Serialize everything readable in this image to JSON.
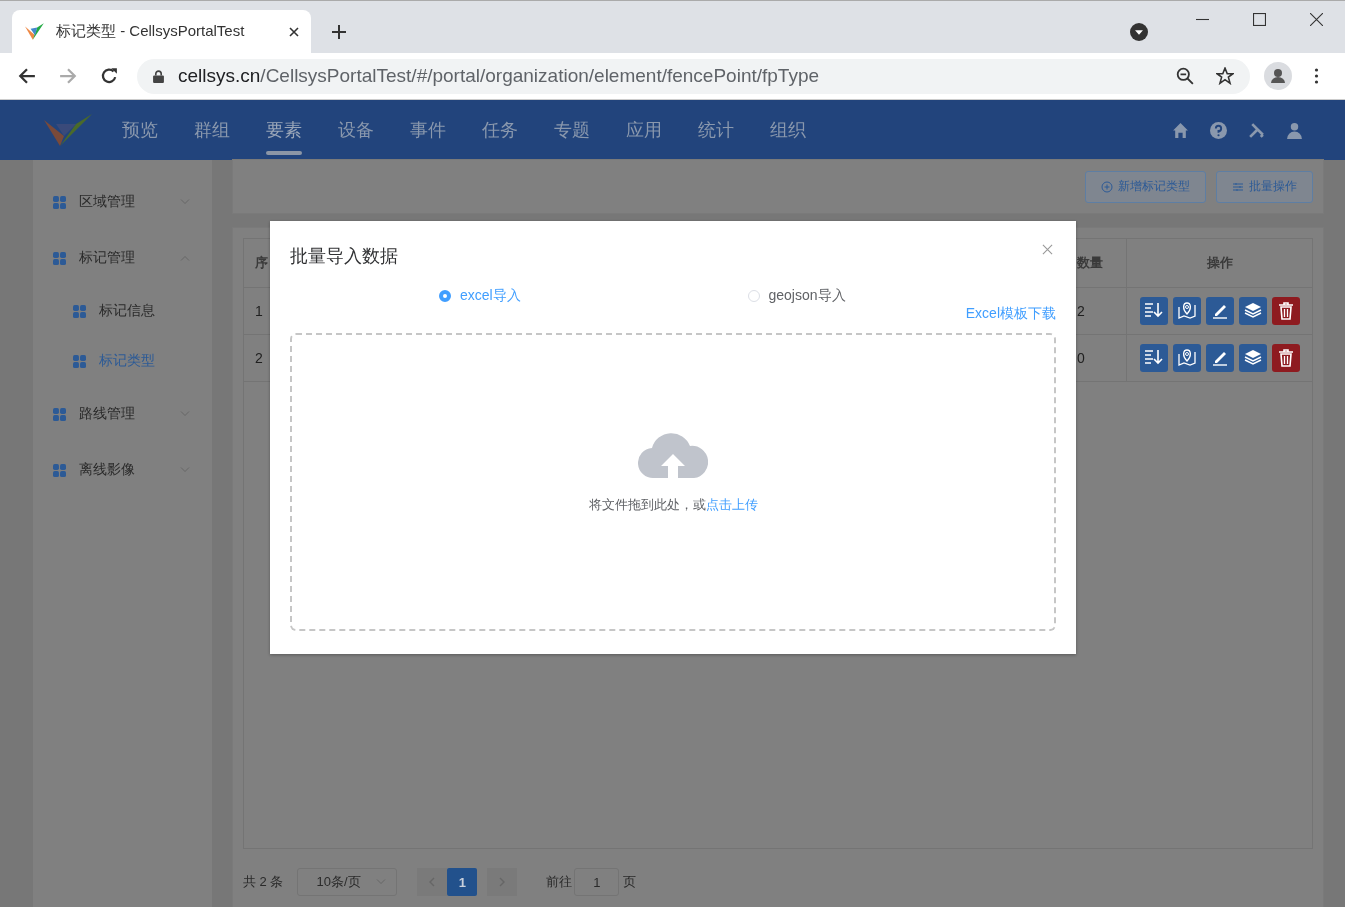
{
  "browser": {
    "tab_title": "标记类型 - CellsysPortalTest",
    "url_host": "cellsys.cn",
    "url_path": "/CellsysPortalTest/#/portal/organization/element/fencePoint/fpType"
  },
  "nav": {
    "items": [
      {
        "label": "预览",
        "selected": false
      },
      {
        "label": "群组",
        "selected": false
      },
      {
        "label": "要素",
        "selected": true
      },
      {
        "label": "设备",
        "selected": false
      },
      {
        "label": "事件",
        "selected": false
      },
      {
        "label": "任务",
        "selected": false
      },
      {
        "label": "专题",
        "selected": false
      },
      {
        "label": "应用",
        "selected": false
      },
      {
        "label": "统计",
        "selected": false
      },
      {
        "label": "组织",
        "selected": false
      }
    ]
  },
  "sidebar": {
    "items": [
      {
        "label": "区域管理",
        "expanded": false,
        "selected": false
      },
      {
        "label": "标记管理",
        "expanded": true,
        "selected": false,
        "children": [
          {
            "label": "标记信息",
            "selected": false
          },
          {
            "label": "标记类型",
            "selected": true
          }
        ]
      },
      {
        "label": "路线管理",
        "expanded": false,
        "selected": false
      },
      {
        "label": "离线影像",
        "expanded": false,
        "selected": false
      }
    ]
  },
  "toolbar": {
    "buttons": [
      {
        "label": "新增标记类型",
        "kind": "add"
      },
      {
        "label": "批量操作",
        "kind": "batch"
      }
    ]
  },
  "table": {
    "columns": [
      "序",
      "数量",
      "操作"
    ],
    "rows": [
      {
        "cells": [
          "1",
          "2"
        ]
      },
      {
        "cells": [
          "2",
          "0"
        ]
      }
    ]
  },
  "pagination": {
    "total": "共 2 条",
    "page_size": "10条/页",
    "pages": [
      {
        "label": "1",
        "selected": true
      }
    ],
    "goto_label": "前往",
    "goto_value": "1",
    "goto_suffix": "页"
  },
  "dialog": {
    "title": "批量导入数据",
    "options": [
      {
        "label": "excel导入",
        "selected": true
      },
      {
        "label": "geojson导入",
        "selected": false
      }
    ],
    "template_link": "Excel模板下载",
    "upload_text": "将文件拖到此处，或",
    "upload_link": "点击上传"
  }
}
